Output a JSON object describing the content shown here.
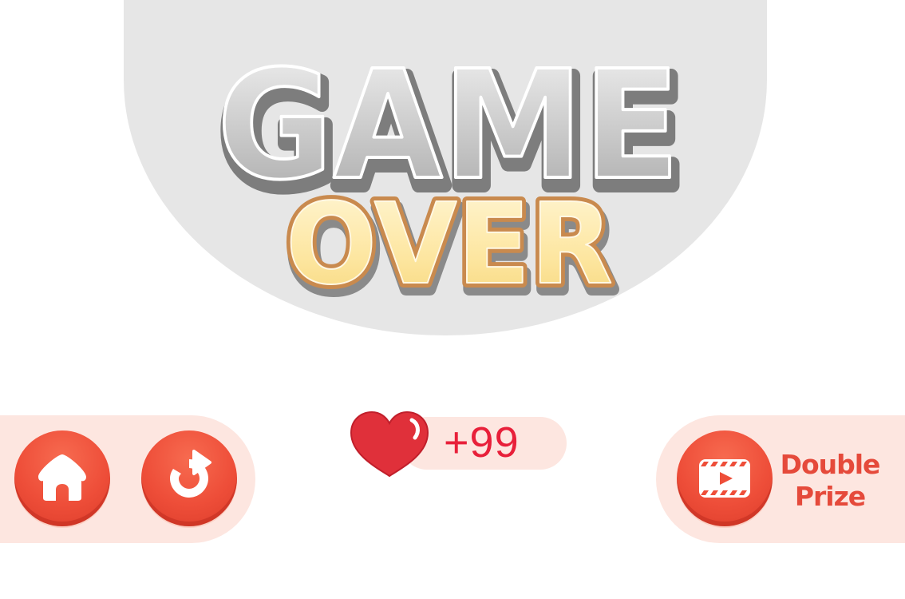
{
  "title": {
    "line1": "GAME",
    "line2": "OVER"
  },
  "reward": {
    "icon": "heart-icon",
    "amount_text": "+99"
  },
  "buttons": {
    "home": {
      "icon": "home-icon"
    },
    "restart": {
      "icon": "restart-icon"
    },
    "double_prize": {
      "icon": "video-icon",
      "label_line1": "Double",
      "label_line2": "Prize"
    }
  },
  "colors": {
    "background": "#ffffff",
    "banner": "#e6e6e6",
    "panel": "#fde6e0",
    "button_red": "#ee4e39",
    "reward_text": "#e8203a",
    "label_text": "#e54a3b",
    "title_game_fill": "#c8c8c8",
    "title_over_fill": "#fde9a8"
  }
}
